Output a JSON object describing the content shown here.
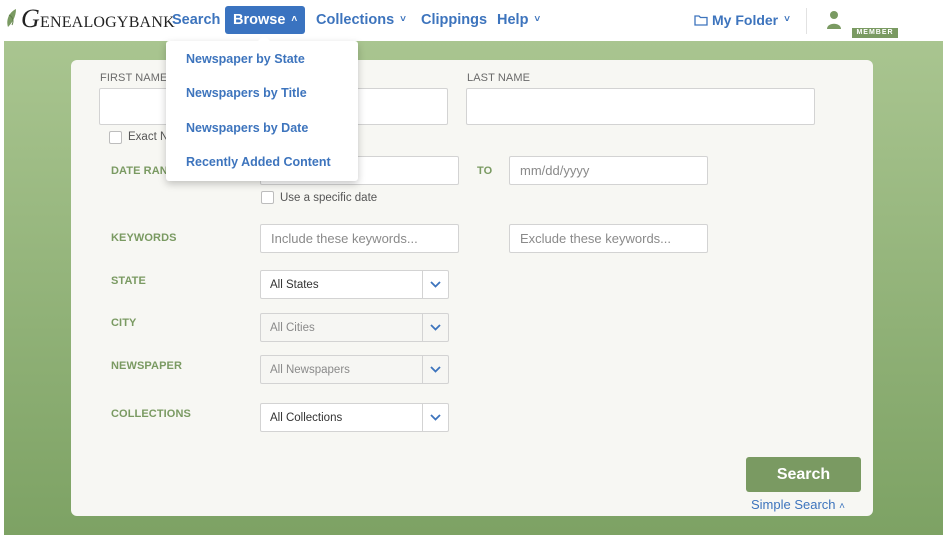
{
  "header": {
    "logo_initial": "G",
    "logo_rest": "ENEALOGY",
    "logo_bank": "BANK",
    "nav": {
      "search": "Search",
      "browse": "Browse",
      "collections": "Collections",
      "clippings": "Clippings",
      "help": "Help"
    },
    "my_folder": "My Folder",
    "member_badge": "MEMBER"
  },
  "browse_menu": {
    "items": [
      "Newspaper by State",
      "Newspapers by Title",
      "Newspapers by Date",
      "Recently Added Content"
    ]
  },
  "form": {
    "first_name_label": "FIRST NAME",
    "last_name_label": "LAST NAME",
    "exact_label": "Exact N",
    "date_range_label": "DATE RANG",
    "to_label": "TO",
    "date_placeholder": "mm/dd/yyyy",
    "specific_date_label": "Use a specific date",
    "keywords_label": "KEYWORDS",
    "include_placeholder": "Include these keywords...",
    "exclude_placeholder": "Exclude these keywords...",
    "state_label": "STATE",
    "state_value": "All States",
    "city_label": "CITY",
    "city_value": "All Cities",
    "newspaper_label": "NEWSPAPER",
    "newspaper_value": "All Newspapers",
    "collections_label": "COLLECTIONS",
    "collections_value": "All Collections",
    "search_button": "Search",
    "simple_search": "Simple Search"
  },
  "colors": {
    "brand_green": "#7a9a62",
    "link_blue": "#3d74bd",
    "active_nav": "#3a73c0"
  }
}
